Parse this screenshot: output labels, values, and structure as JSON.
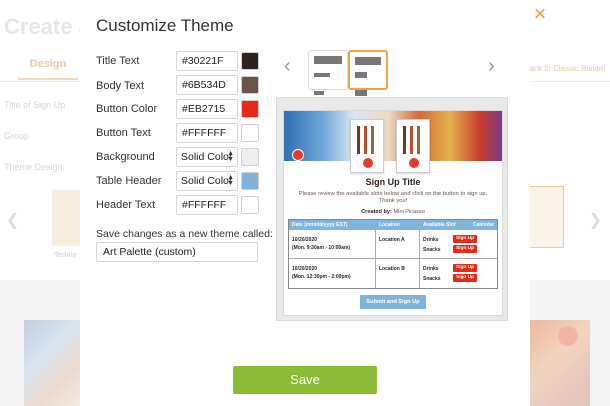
{
  "background": {
    "title": "Create a",
    "tab_design": "Design",
    "back_link": "Back to Classic Builder",
    "side_items": [
      "Title of Sign Up",
      "Group",
      "Theme Design"
    ],
    "card_caption": "Techno"
  },
  "modal": {
    "title": "Customize Theme",
    "close_icon": "×",
    "fields": [
      {
        "label": "Title Text",
        "value": "#30221F",
        "color": "#30221F",
        "kind": "text"
      },
      {
        "label": "Body Text",
        "value": "#6B534D",
        "color": "#6B534D",
        "kind": "text"
      },
      {
        "label": "Button Color",
        "value": "#EB2715",
        "color": "#EB2715",
        "kind": "text"
      },
      {
        "label": "Button Text",
        "value": "#FFFFFF",
        "color": "#FFFFFF",
        "kind": "text"
      },
      {
        "label": "Background",
        "value": "Solid Color",
        "color": "#EEEEEE",
        "kind": "select"
      },
      {
        "label": "Table Header",
        "value": "Solid Color",
        "color": "#7FB4DC",
        "kind": "select"
      },
      {
        "label": "Header Text",
        "value": "#FFFFFF",
        "color": "#FFFFFF",
        "kind": "text"
      }
    ],
    "save_as_label": "Save changes as a new theme called:",
    "theme_name": "Art Palette (custom)",
    "save_button": "Save"
  },
  "preview": {
    "signup_title": "Sign Up Title",
    "instructions": "Please review the available slots below and click on the button to sign up. Thank you!",
    "created_by_label": "Created by:",
    "created_by_name": "Mini Picasso",
    "columns": [
      "Date (mm/dd/yyyy EST)",
      "Location",
      "Available Slot",
      "Calendar"
    ],
    "rows": [
      {
        "date": "10/20/2020",
        "time": "(Mon. 9:30am - 10:00am)",
        "location": "Location A",
        "slots": [
          "Drinks",
          "Snacks"
        ],
        "button": "Sign Up"
      },
      {
        "date": "10/20/2020",
        "time": "(Mon. 12:30pm - 2:00pm)",
        "location": "Location B",
        "slots": [
          "Drinks",
          "Snacks"
        ],
        "button": "Sign Up"
      }
    ],
    "submit": "Submit and Sign Up"
  }
}
